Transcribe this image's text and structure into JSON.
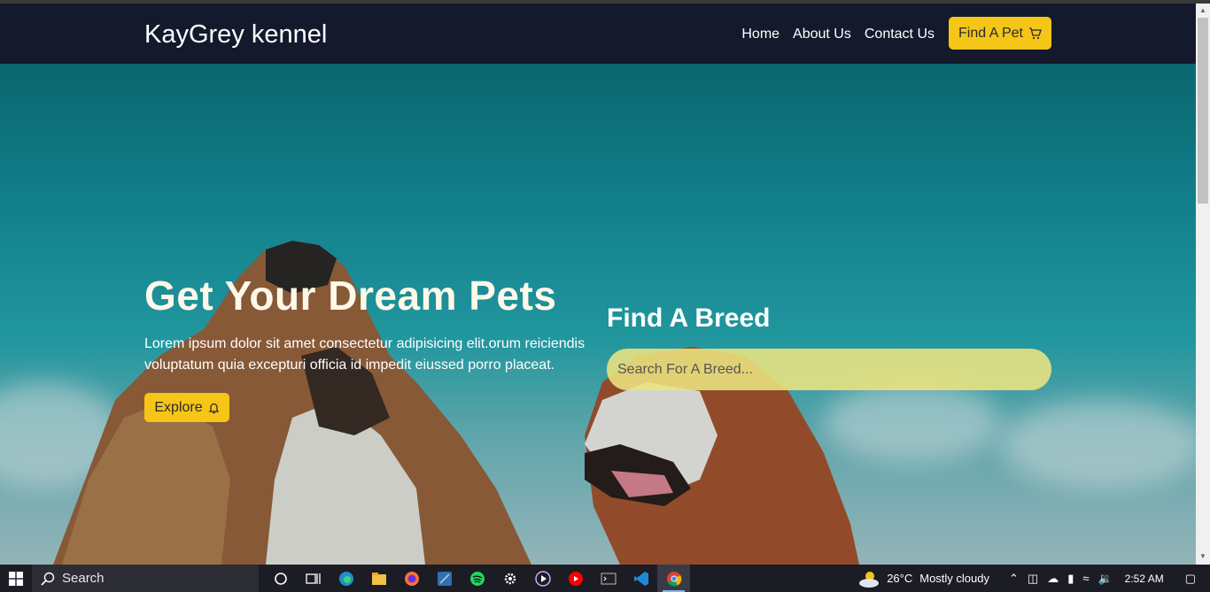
{
  "nav": {
    "brand": "KayGrey kennel",
    "links": [
      "Home",
      "About Us",
      "Contact Us"
    ],
    "cta_label": "Find A Pet",
    "cta_icon": "cart-icon"
  },
  "hero": {
    "title": "Get Your Dream Pets",
    "text": "Lorem ipsum dolor sit amet consectetur adipisicing elit.orum reiciendis voluptatum quia excepturi officia id impedit eiussed porro placeat.",
    "explore_label": "Explore",
    "explore_icon": "bell-icon"
  },
  "breed": {
    "title": "Find A Breed",
    "placeholder": "Search For A Breed..."
  },
  "taskbar": {
    "search_label": "Search",
    "weather_temp": "26°C",
    "weather_desc": "Mostly cloudy",
    "time": "2:52 AM",
    "icons": [
      "cortana-icon",
      "task-view-icon",
      "edge-icon",
      "file-explorer-icon",
      "firefox-icon",
      "app-icon",
      "spotify-icon",
      "settings-icon",
      "media-player-icon",
      "youtube-music-icon",
      "terminal-icon",
      "vscode-icon",
      "chrome-icon"
    ]
  },
  "colors": {
    "accent": "#f5c518",
    "nav_bg": "#141a2c",
    "hero_sky": "#168e9a"
  }
}
